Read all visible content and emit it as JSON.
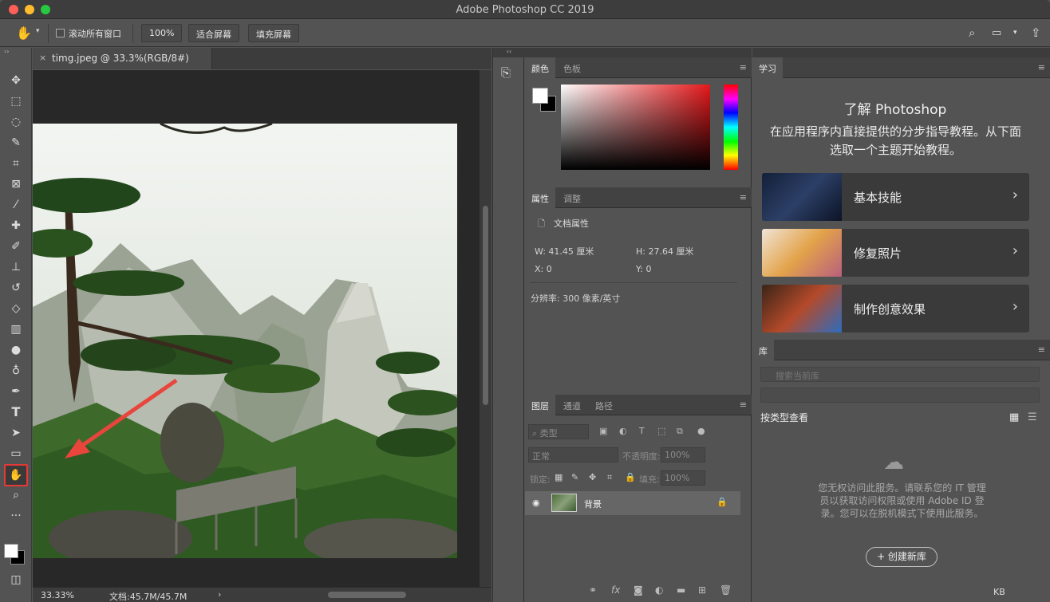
{
  "window": {
    "title": "Adobe Photoshop CC 2019"
  },
  "options_bar": {
    "scroll_all_windows": "滚动所有窗口",
    "zoom_100": "100%",
    "fit_screen": "适合屏幕",
    "fill_screen": "填充屏幕"
  },
  "document": {
    "tab_title": "timg.jpeg @ 33.3%(RGB/8#)",
    "tab_close": "×",
    "status_zoom": "33.33%",
    "status_doc": "文档:45.7M/45.7M",
    "status_arrow": "›"
  },
  "toolbar": {
    "active_tool": "hand-tool"
  },
  "color_panel": {
    "tabs": [
      "颜色",
      "色板"
    ]
  },
  "properties_panel": {
    "tabs": [
      "属性",
      "调整"
    ],
    "section_title": "文档属性",
    "width": "W: 41.45 厘米",
    "height": "H: 27.64 厘米",
    "x": "X: 0",
    "y": "Y: 0",
    "resolution": "分辨率: 300 像素/英寸"
  },
  "layers_panel": {
    "tabs": [
      "图层",
      "通道",
      "路径"
    ],
    "kind_filter": "类型",
    "blend_mode": "正常",
    "opacity_label": "不透明度:",
    "opacity_value": "100%",
    "lock_label": "锁定:",
    "fill_label": "填充:",
    "fill_value": "100%",
    "layer_name": "背景"
  },
  "learn_panel": {
    "tab": "学习",
    "title": "了解 Photoshop",
    "description": "在应用程序内直接提供的分步指导教程。从下面选取一个主题开始教程。",
    "cards": [
      {
        "label": "基本技能"
      },
      {
        "label": "修复照片"
      },
      {
        "label": "制作创意效果"
      }
    ]
  },
  "library_panel": {
    "tab": "库",
    "search_placeholder": "搜索当前库",
    "sort_label": "按类型查看",
    "message": "您无权访问此服务。请联系您的 IT 管理员以获取访问权限或使用 Adobe ID 登录。您可以在脱机模式下使用此服务。",
    "create_button": "+ 创建新库",
    "size": "KB"
  },
  "colors": {
    "accent_red": "#e53935",
    "panel_bg": "#535353",
    "canvas_bg": "#282828"
  }
}
